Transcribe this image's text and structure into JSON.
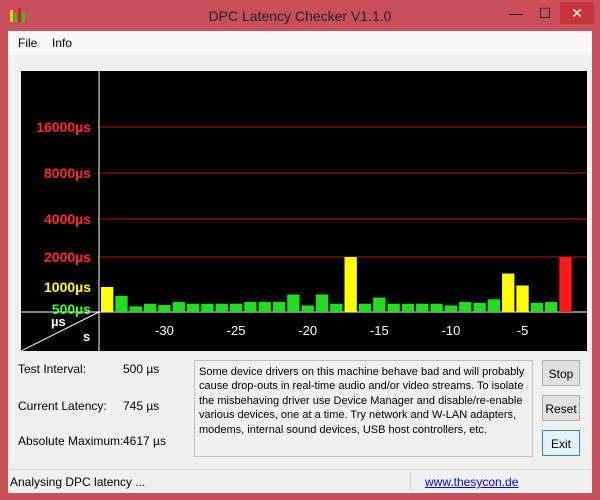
{
  "window": {
    "title": "DPC Latency Checker V1.1.0",
    "minimize": "—",
    "maximize": "☐",
    "close": "✕"
  },
  "menu": {
    "file": "File",
    "info": "Info"
  },
  "chart_data": {
    "type": "bar",
    "y_unit_label": "µs",
    "x_unit_label": "s",
    "yticks": [
      {
        "label": "16000µs",
        "value": 16000,
        "color": "#ff2a2a"
      },
      {
        "label": "8000µs",
        "value": 8000,
        "color": "#ff2a2a"
      },
      {
        "label": "4000µs",
        "value": 4000,
        "color": "#ff2a2a"
      },
      {
        "label": "2000µs",
        "value": 2000,
        "color": "#ff2a2a"
      },
      {
        "label": "1000µs",
        "value": 1000,
        "color": "#ffff00"
      },
      {
        "label": "500µs",
        "value": 500,
        "color": "#44ff33"
      }
    ],
    "xticks": [
      {
        "label": "-30",
        "value": -30
      },
      {
        "label": "-25",
        "value": -25
      },
      {
        "label": "-20",
        "value": -20
      },
      {
        "label": "-15",
        "value": -15
      },
      {
        "label": "-10",
        "value": -10
      },
      {
        "label": "-5",
        "value": -5
      }
    ],
    "x_range": [
      -34,
      0
    ],
    "bars": [
      {
        "t": -34,
        "value": 1000,
        "color": "#ffff00"
      },
      {
        "t": -33,
        "value": 800,
        "color": "#22dd22"
      },
      {
        "t": -32,
        "value": 560,
        "color": "#22dd22"
      },
      {
        "t": -31,
        "value": 620,
        "color": "#22dd22"
      },
      {
        "t": -30,
        "value": 590,
        "color": "#22dd22"
      },
      {
        "t": -29,
        "value": 660,
        "color": "#22dd22"
      },
      {
        "t": -28,
        "value": 620,
        "color": "#22dd22"
      },
      {
        "t": -27,
        "value": 620,
        "color": "#22dd22"
      },
      {
        "t": -26,
        "value": 620,
        "color": "#22dd22"
      },
      {
        "t": -25,
        "value": 620,
        "color": "#22dd22"
      },
      {
        "t": -24,
        "value": 660,
        "color": "#22dd22"
      },
      {
        "t": -23,
        "value": 660,
        "color": "#22dd22"
      },
      {
        "t": -22,
        "value": 660,
        "color": "#22dd22"
      },
      {
        "t": -21,
        "value": 830,
        "color": "#22dd22"
      },
      {
        "t": -20,
        "value": 580,
        "color": "#22dd22"
      },
      {
        "t": -19,
        "value": 830,
        "color": "#22dd22"
      },
      {
        "t": -18,
        "value": 620,
        "color": "#22dd22"
      },
      {
        "t": -17,
        "value": 2000,
        "color": "#ffff00"
      },
      {
        "t": -16,
        "value": 620,
        "color": "#22dd22"
      },
      {
        "t": -15,
        "value": 760,
        "color": "#22dd22"
      },
      {
        "t": -14,
        "value": 620,
        "color": "#22dd22"
      },
      {
        "t": -13,
        "value": 620,
        "color": "#22dd22"
      },
      {
        "t": -12,
        "value": 620,
        "color": "#22dd22"
      },
      {
        "t": -11,
        "value": 620,
        "color": "#22dd22"
      },
      {
        "t": -10,
        "value": 580,
        "color": "#22dd22"
      },
      {
        "t": -9,
        "value": 660,
        "color": "#22dd22"
      },
      {
        "t": -8,
        "value": 640,
        "color": "#22dd22"
      },
      {
        "t": -7,
        "value": 720,
        "color": "#22dd22"
      },
      {
        "t": -6,
        "value": 1450,
        "color": "#ffff00"
      },
      {
        "t": -5,
        "value": 1050,
        "color": "#ffff00"
      },
      {
        "t": -4,
        "value": 640,
        "color": "#22dd22"
      },
      {
        "t": -3,
        "value": 660,
        "color": "#22dd22"
      },
      {
        "t": -2,
        "value": 2000,
        "color": "#ff1a1a"
      }
    ]
  },
  "stats": {
    "test_interval_label": "Test Interval:",
    "test_interval_value": "500 µs",
    "current_latency_label": "Current Latency:",
    "current_latency_value": "745 µs",
    "absolute_max_label": "Absolute Maximum:",
    "absolute_max_value": "4617 µs"
  },
  "info_text": "Some device drivers on this machine behave bad and will probably cause drop-outs in real-time audio and/or video streams. To isolate the misbehaving driver use Device Manager and disable/re-enable various devices, one at a time. Try network and W-LAN adapters, modems, internal sound devices, USB host controllers, etc.",
  "buttons": {
    "stop": "Stop",
    "reset": "Reset",
    "exit": "Exit"
  },
  "status": {
    "text": "Analysing DPC latency ...",
    "link": "www.thesycon.de"
  }
}
